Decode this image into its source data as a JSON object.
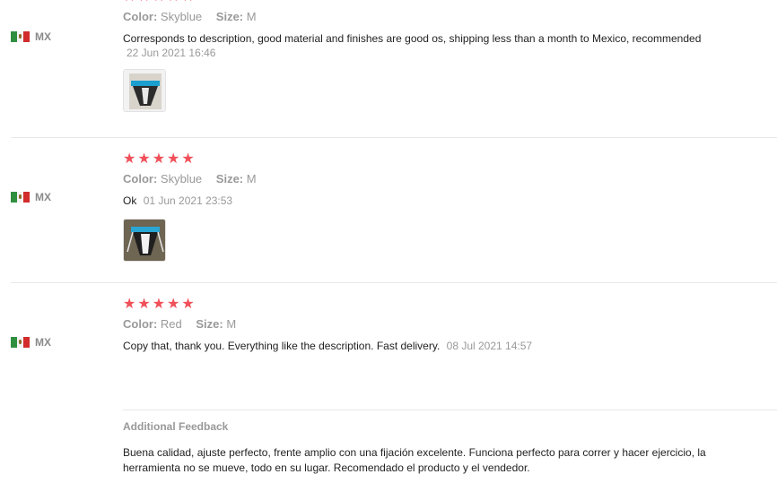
{
  "reviews": [
    {
      "country": "MX",
      "rating": 5,
      "color_label": "Color:",
      "color": "Skyblue",
      "size_label": "Size:",
      "size": "M",
      "text": "Corresponds to description, good material and finishes are good os, shipping less than a month to Mexico, recommended",
      "date": "22 Jun 2021 16:46"
    },
    {
      "country": "MX",
      "rating": 5,
      "color_label": "Color:",
      "color": "Skyblue",
      "size_label": "Size:",
      "size": "M",
      "text": "Ok",
      "date": "01 Jun 2021 23:53"
    },
    {
      "country": "MX",
      "rating": 5,
      "color_label": "Color:",
      "color": "Red",
      "size_label": "Size:",
      "size": "M",
      "text": "Copy that, thank you. Everything like the description. Fast delivery.",
      "date": "08 Jul 2021 14:57"
    }
  ],
  "additional_feedback": {
    "title": "Additional Feedback",
    "text": "Buena calidad, ajuste perfecto, frente amplio con una fijación excelente. Funciona perfecto para correr y hacer ejercicio, la herramienta no se mueve, todo en su lugar. Recomendado el producto y el vendedor."
  },
  "colors": {
    "star": "#f0505a",
    "muted": "#999999",
    "divider": "#e8e8e8"
  },
  "icons": {
    "flag": "mexico-flag-icon",
    "star": "star-icon"
  }
}
